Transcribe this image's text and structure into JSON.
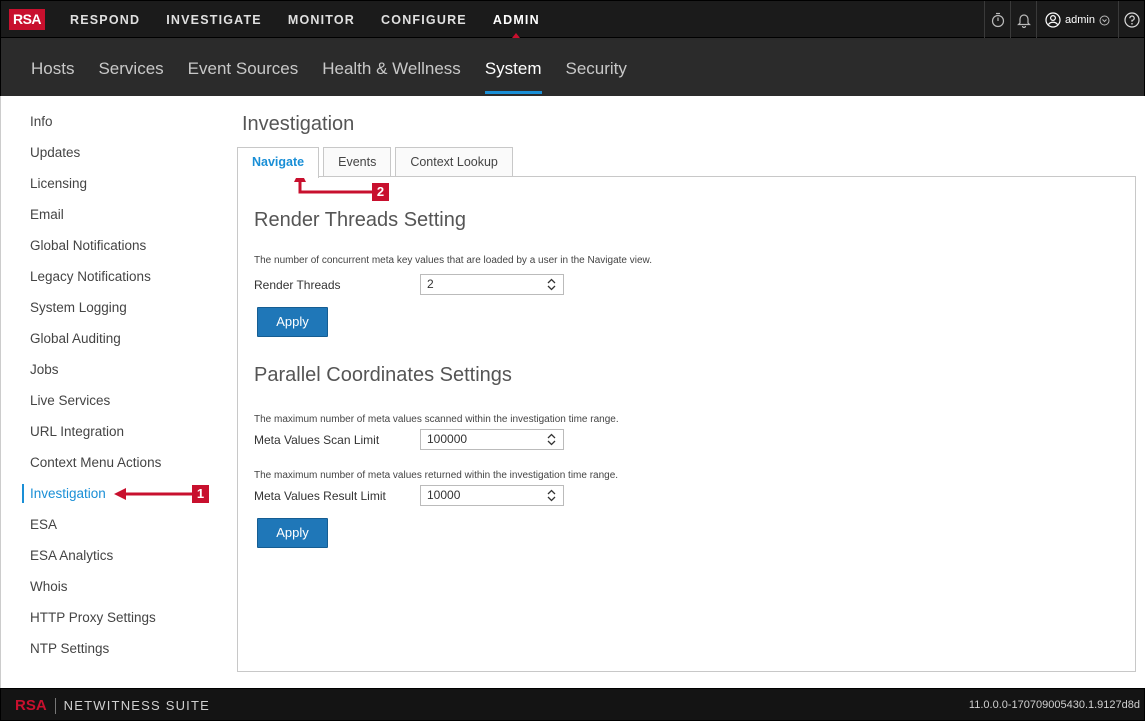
{
  "app": {
    "logo_text": "RSA",
    "brand_color": "#c8102e",
    "accent_color": "#1a8fd6"
  },
  "main_nav": {
    "items": [
      {
        "label": "RESPOND"
      },
      {
        "label": "INVESTIGATE"
      },
      {
        "label": "MONITOR"
      },
      {
        "label": "CONFIGURE"
      },
      {
        "label": "ADMIN",
        "active": true
      }
    ]
  },
  "top_right": {
    "icons": [
      "stopwatch-icon",
      "bell-icon",
      "user-icon",
      "help-icon"
    ],
    "user_label": "admin"
  },
  "sub_nav": {
    "items": [
      {
        "label": "Hosts"
      },
      {
        "label": "Services"
      },
      {
        "label": "Event Sources"
      },
      {
        "label": "Health & Wellness"
      },
      {
        "label": "System",
        "active": true
      },
      {
        "label": "Security"
      }
    ]
  },
  "sidebar": {
    "items": [
      {
        "label": "Info"
      },
      {
        "label": "Updates"
      },
      {
        "label": "Licensing"
      },
      {
        "label": "Email"
      },
      {
        "label": "Global Notifications"
      },
      {
        "label": "Legacy Notifications"
      },
      {
        "label": "System Logging"
      },
      {
        "label": "Global Auditing"
      },
      {
        "label": "Jobs"
      },
      {
        "label": "Live Services"
      },
      {
        "label": "URL Integration"
      },
      {
        "label": "Context Menu Actions"
      },
      {
        "label": "Investigation",
        "active": true
      },
      {
        "label": "ESA"
      },
      {
        "label": "ESA Analytics"
      },
      {
        "label": "Whois"
      },
      {
        "label": "HTTP Proxy Settings"
      },
      {
        "label": "NTP Settings"
      }
    ]
  },
  "page": {
    "title": "Investigation"
  },
  "tabs": [
    {
      "label": "Navigate",
      "active": true
    },
    {
      "label": "Events"
    },
    {
      "label": "Context Lookup"
    }
  ],
  "render_threads": {
    "title": "Render Threads Setting",
    "description": "The number of concurrent meta key values that are loaded by a user in the Navigate view.",
    "field_label": "Render Threads",
    "value": "2",
    "apply_label": "Apply"
  },
  "parallel_coords": {
    "title": "Parallel Coordinates Settings",
    "scan_description": "The maximum number of meta values scanned within the investigation time range.",
    "scan_label": "Meta Values Scan Limit",
    "scan_value": "100000",
    "result_description": "The maximum number of meta values returned within the investigation time range.",
    "result_label": "Meta Values Result Limit",
    "result_value": "10000",
    "apply_label": "Apply"
  },
  "callouts": {
    "one": "1",
    "two": "2"
  },
  "footer": {
    "brand": "RSA",
    "suite": "NETWITNESS SUITE",
    "version": "11.0.0.0-170709005430.1.9127d8d"
  }
}
